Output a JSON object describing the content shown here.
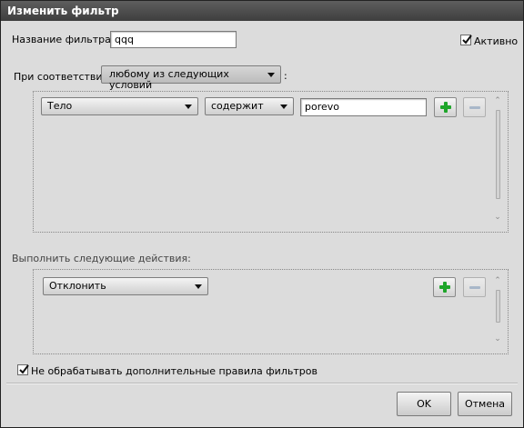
{
  "window": {
    "title": "Изменить фильтр"
  },
  "filter_name": {
    "label": "Название фильтра:",
    "value": "qqq"
  },
  "active": {
    "label": "Активно",
    "checked": true
  },
  "match": {
    "prefix": "При соответствии",
    "selected": "любому из следующих условий",
    "suffix": ":"
  },
  "condition": {
    "field": "Тело",
    "operator": "содержит",
    "value": "porevo"
  },
  "actions": {
    "label": "Выполнить следующие действия:",
    "action": "Отклонить"
  },
  "stop_rules": {
    "label": "Не обрабатывать дополнительные правила фильтров",
    "checked": true
  },
  "buttons": {
    "ok": "OK",
    "cancel": "Отмена"
  },
  "icons": {
    "add": "plus-icon",
    "remove": "minus-icon",
    "check": "checkmark-icon"
  }
}
